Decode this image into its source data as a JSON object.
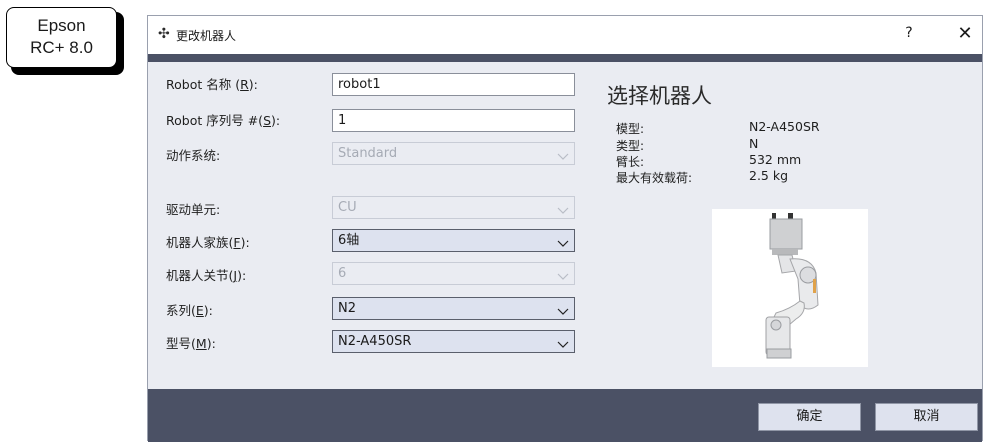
{
  "badge": {
    "line1": "Epson",
    "line2": "RC+ 8.0"
  },
  "window": {
    "title": "更改机器人",
    "help": "?",
    "close": "✕"
  },
  "form": {
    "robot_name": {
      "label_pre": "Robot 名称 (",
      "label_key": "R",
      "label_post": "):",
      "value": "robot1"
    },
    "robot_serial": {
      "label_pre": "Robot 序列号 #(",
      "label_key": "S",
      "label_post": "):",
      "value": "1"
    },
    "motion_system": {
      "label": "动作系统:",
      "value": "Standard"
    },
    "drive_unit": {
      "label": "驱动单元:",
      "value": "CU"
    },
    "robot_family": {
      "label_pre": "机器人家族(",
      "label_key": "F",
      "label_post": "):",
      "value": "6轴"
    },
    "robot_joints": {
      "label_pre": "机器人关节(",
      "label_key": "J",
      "label_post": "):",
      "value": "6"
    },
    "series": {
      "label_pre": "系列(",
      "label_key": "E",
      "label_post": "):",
      "value": "N2"
    },
    "model": {
      "label_pre": "型号(",
      "label_key": "M",
      "label_post": "):",
      "value": "N2-A450SR"
    }
  },
  "selection": {
    "title": "选择机器人",
    "info": [
      {
        "key": "模型:",
        "value": "N2-A450SR"
      },
      {
        "key": "类型:",
        "value": "N"
      },
      {
        "key": "臂长:",
        "value": "532  mm"
      },
      {
        "key": "最大有效载荷:",
        "value": "2.5  kg"
      }
    ]
  },
  "buttons": {
    "ok": "确定",
    "cancel": "取消"
  },
  "colors": {
    "band": "#4b5165",
    "dialog_bg": "#eaecf2",
    "combo_bg": "#dde2ef"
  }
}
